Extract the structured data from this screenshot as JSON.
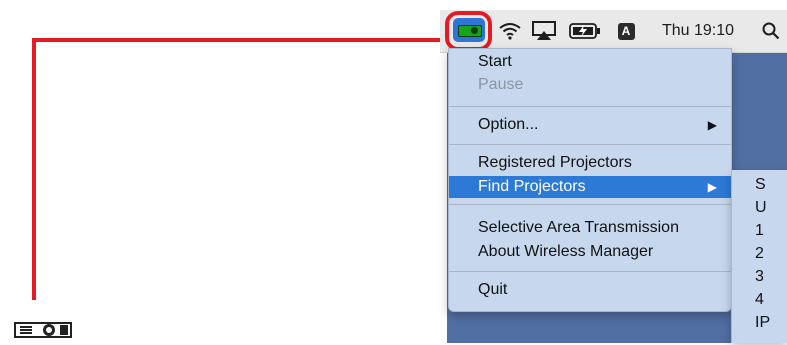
{
  "menubar": {
    "app_icon": "projector-icon",
    "wifi_icon": "wifi-icon",
    "airplay_icon": "airplay-icon",
    "battery_icon": "battery-charging-icon",
    "input_source": "A",
    "time": "Thu 19:10",
    "search_icon": "search-icon"
  },
  "menu": {
    "items": [
      {
        "label": "Start",
        "disabled": false
      },
      {
        "label": "Pause",
        "disabled": true
      },
      {
        "label": "Option...",
        "submenu": true
      },
      {
        "label": "Registered Projectors"
      },
      {
        "label": "Find Projectors",
        "submenu": true,
        "selected": true
      },
      {
        "label": "Selective Area Transmission"
      },
      {
        "label": "About Wireless Manager"
      },
      {
        "label": "Quit"
      }
    ],
    "arrow": "▶"
  },
  "submenu": {
    "items": [
      "S",
      "U",
      "1",
      "2",
      "3",
      "4",
      "IP"
    ]
  },
  "colors": {
    "callout": "#e31b23",
    "highlight": "#2d7ad6",
    "menu_bg": "#c7d8ee",
    "desktop": "#526fa3"
  }
}
